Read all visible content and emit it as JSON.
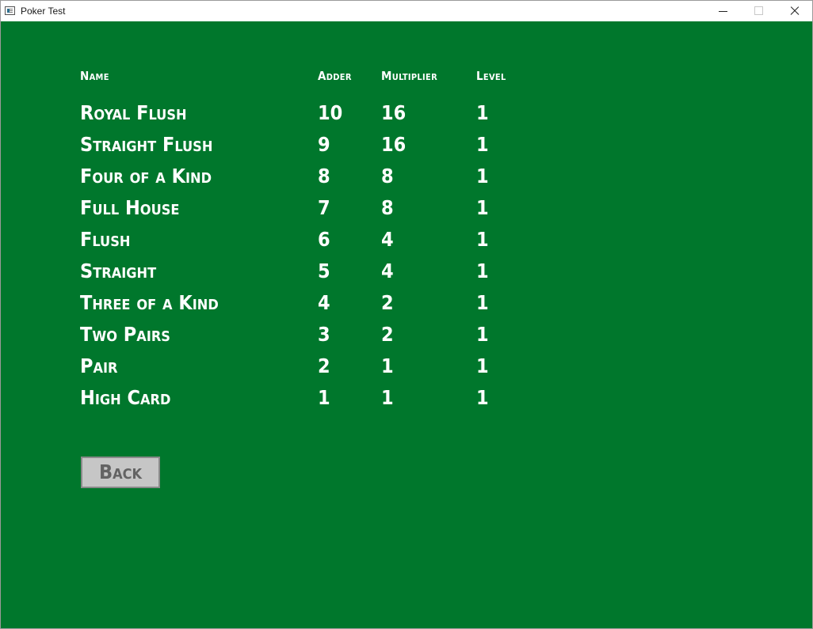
{
  "window": {
    "title": "Poker Test"
  },
  "table": {
    "headers": {
      "name": "Name",
      "adder": "Adder",
      "multiplier": "Multiplier",
      "level": "Level"
    },
    "rows": [
      {
        "name": "Royal Flush",
        "adder": "10",
        "multiplier": "16",
        "level": "1"
      },
      {
        "name": "Straight Flush",
        "adder": "9",
        "multiplier": "16",
        "level": "1"
      },
      {
        "name": "Four of a Kind",
        "adder": "8",
        "multiplier": "8",
        "level": "1"
      },
      {
        "name": "Full House",
        "adder": "7",
        "multiplier": "8",
        "level": "1"
      },
      {
        "name": "Flush",
        "adder": "6",
        "multiplier": "4",
        "level": "1"
      },
      {
        "name": "Straight",
        "adder": "5",
        "multiplier": "4",
        "level": "1"
      },
      {
        "name": "Three of a Kind",
        "adder": "4",
        "multiplier": "2",
        "level": "1"
      },
      {
        "name": "Two Pairs",
        "adder": "3",
        "multiplier": "2",
        "level": "1"
      },
      {
        "name": "Pair",
        "adder": "2",
        "multiplier": "1",
        "level": "1"
      },
      {
        "name": "High Card",
        "adder": "1",
        "multiplier": "1",
        "level": "1"
      }
    ]
  },
  "back_button": {
    "label": "Back"
  },
  "colors": {
    "background": "#00772c",
    "text": "#ffffff",
    "button_bg": "#c6c6c6",
    "button_text": "#636363"
  },
  "icons": {
    "app": "app-window-icon",
    "minimize": "minimize-icon",
    "maximize": "maximize-icon",
    "close": "close-icon"
  }
}
